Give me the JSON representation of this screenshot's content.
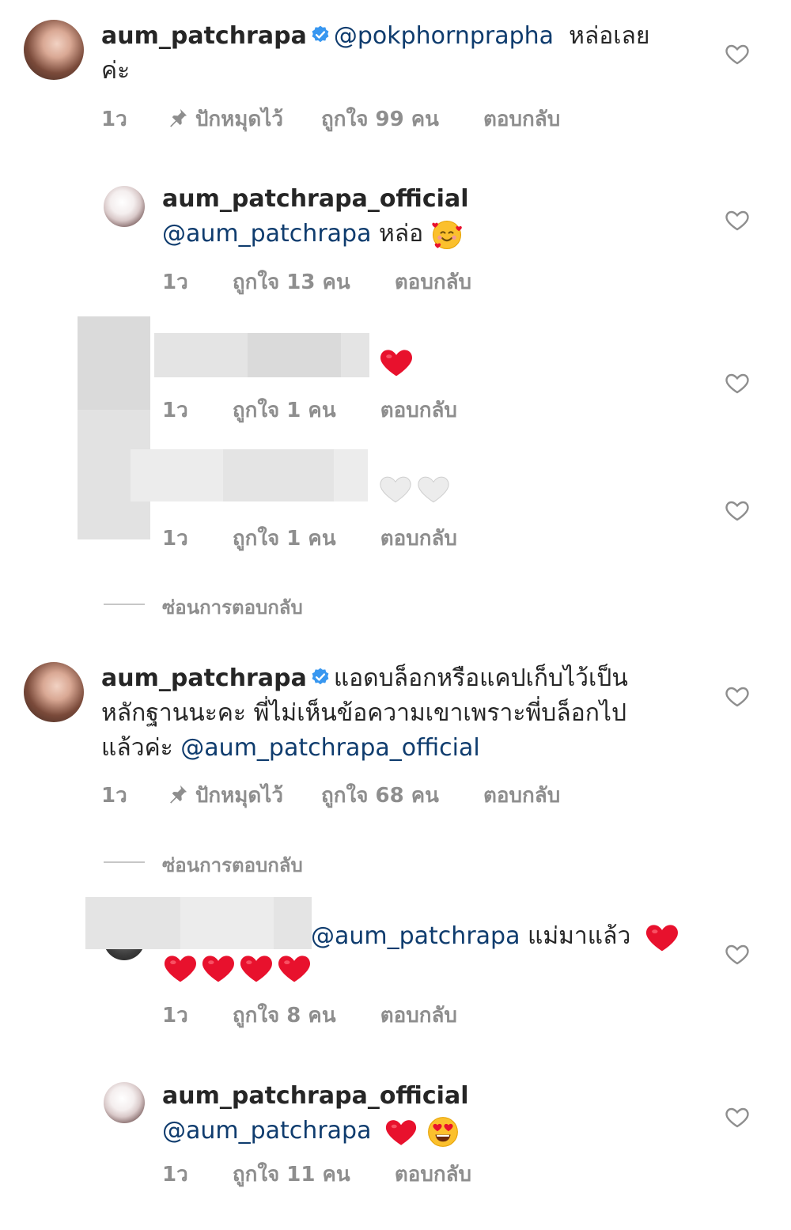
{
  "comments": [
    {
      "username": "aum_patchrapa",
      "mention": "@pokphornprapha",
      "text_line1": "หล่อเลย",
      "text_line2": "ค่ะ",
      "time": "1ว",
      "pinned_label": "ปักหมุดไว้",
      "likes": "ถูกใจ 99 คน",
      "reply": "ตอบกลับ"
    },
    {
      "username": "aum_patchrapa_official",
      "mention": "@aum_patchrapa",
      "text": "หล่อ",
      "time": "1ว",
      "likes": "ถูกใจ 13 คน",
      "reply": "ตอบกลับ"
    },
    {
      "time": "1ว",
      "likes": "ถูกใจ 1 คน",
      "reply": "ตอบกลับ"
    },
    {
      "time": "1ว",
      "likes": "ถูกใจ 1 คน",
      "reply": "ตอบกลับ"
    },
    {
      "username": "aum_patchrapa",
      "text_line1": "แอดบล็อกหรือแคปเก็บไว้เป็น",
      "text_line2": "หลักฐานนะคะ  พี่ไม่เห็นข้อความเขาเพราะพี่บล็อกไป",
      "text_line3": "แล้วค่ะ",
      "mention": "@aum_patchrapa_official",
      "time": "1ว",
      "pinned_label": "ปักหมุดไว้",
      "likes": "ถูกใจ 68 คน",
      "reply": "ตอบกลับ"
    },
    {
      "mention": "@aum_patchrapa",
      "text": "แม่มาแล้ว",
      "time": "1ว",
      "likes": "ถูกใจ 8 คน",
      "reply": "ตอบกลับ"
    },
    {
      "username": "aum_patchrapa_official",
      "mention": "@aum_patchrapa",
      "time": "1ว",
      "likes": "ถูกใจ 11 คน",
      "reply": "ตอบกลับ"
    }
  ],
  "hide_replies_label": "ซ่อนการตอบกลับ",
  "icons": {
    "verified": "verified-badge-icon",
    "pin": "pin-icon",
    "like": "heart-outline-icon",
    "red_heart": "red-heart-emoji",
    "white_heart": "white-heart-emoji",
    "smiling_hearts": "smiling-face-with-hearts-emoji",
    "heart_eyes": "heart-eyes-emoji"
  },
  "colors": {
    "mention": "#0f3c6e",
    "verified": "#3897f0",
    "meta": "#8e8e8e",
    "red_heart": "#e8112d"
  }
}
